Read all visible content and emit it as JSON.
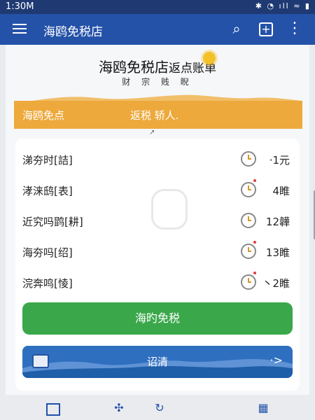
{
  "status_bar": {
    "time": "1:30",
    "time_suffix": "M",
    "icons_text": "✱ ◔ ıll ≈ ▮"
  },
  "app_bar": {
    "title": "海鸥免税店",
    "search_icon": "search-icon",
    "add_icon": "add-icon",
    "more_icon": "more-icon"
  },
  "header": {
    "title": "海鸥免税店",
    "title_suffix": "返点账单",
    "subtitle": "财 宗 贱 睨"
  },
  "banner": {
    "left": "海鸥免点",
    "middle": "返税  轿人."
  },
  "rows": [
    {
      "label": "涕夯时[詰]",
      "value": "·1元"
    },
    {
      "label": "涍涞鸱[表]",
      "value": "4睢"
    },
    {
      "label": "近究吗鹍[耕]",
      "value": "12韡"
    },
    {
      "label": "海夯吗[绍]",
      "value": "13睢"
    },
    {
      "label": "浣奔鸣[㥄]",
      "value": "丶2睢"
    }
  ],
  "primary_button": {
    "label": "海旳免税"
  },
  "secondary_button": {
    "label": "诏清",
    "arrow": "·>"
  },
  "bottom_nav": [
    {
      "name": "nav-home-icon"
    },
    {
      "name": "nav-settings-icon"
    },
    {
      "name": "nav-refresh-icon"
    },
    {
      "name": "nav-apps-icon"
    }
  ],
  "colors": {
    "brand": "#2452a8",
    "accent": "#eda93c",
    "success": "#3aa84a"
  }
}
